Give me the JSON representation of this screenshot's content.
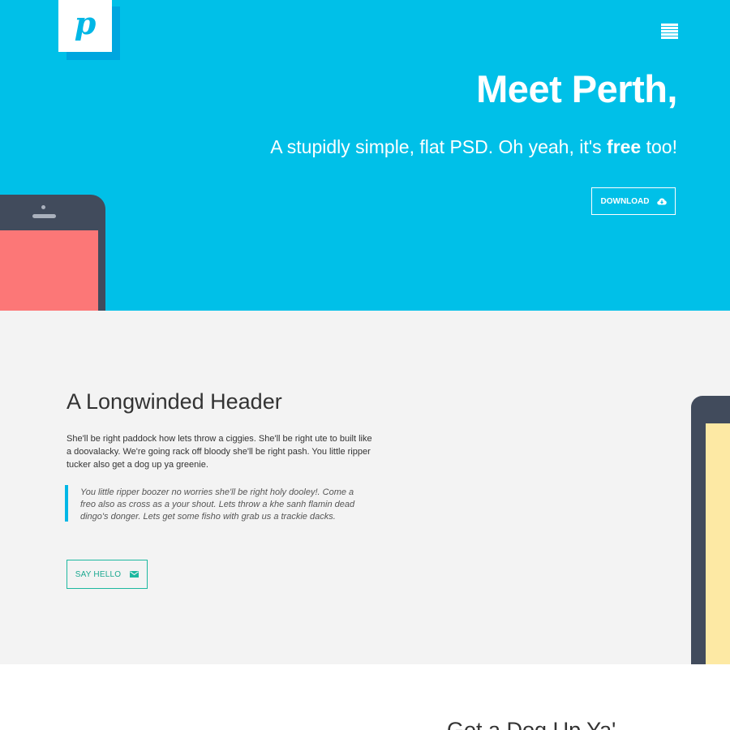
{
  "header": {
    "logo_letter": "p",
    "menu_icon": "hamburger-icon"
  },
  "hero": {
    "title": "Meet Perth,",
    "subtitle_before": "A stupidly simple, flat PSD. Oh yeah, it's ",
    "subtitle_bold": "free",
    "subtitle_after": " too!",
    "download_label": "DOWNLOAD",
    "download_icon": "cloud-download-icon"
  },
  "about": {
    "title": "A Longwinded Header",
    "body": "She'll be right paddock how lets throw a ciggies. She'll be right ute to built like a doovalacky. We're going rack off bloody she'll be right pash. You little ripper tucker also get a dog up ya greenie.",
    "quote": "You little ripper boozer no worries she'll be right holy dooley!. Come a freo also as cross as a your shout. Lets throw a khe sanh flamin dead dingo's donger. Lets get some fisho with grab us a trackie dacks.",
    "cta_label": "SAY HELLO",
    "cta_icon": "envelope-icon"
  },
  "next_section": {
    "title": "Get a Dog Up Ya'"
  },
  "colors": {
    "hero_bg": "#00c0e8",
    "section_bg": "#f3f3f3",
    "accent_teal": "#1db8a0",
    "quote_bar": "#00b7e6",
    "phone_body": "#414b5c",
    "phone_screen_red": "#fc7777",
    "phone_screen_yellow": "#fde9a4"
  }
}
